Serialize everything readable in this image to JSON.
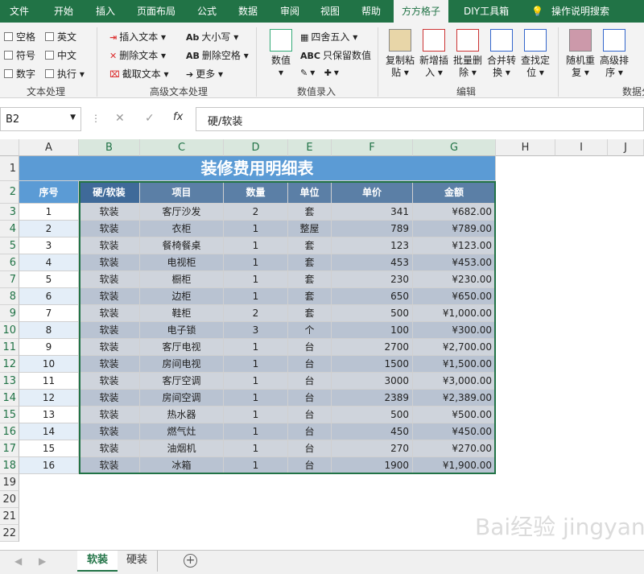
{
  "tabs": [
    "文件",
    "开始",
    "插入",
    "页面布局",
    "公式",
    "数据",
    "审阅",
    "视图",
    "帮助",
    "方方格子",
    "DIY工具箱",
    "操作说明搜索"
  ],
  "ribbon": {
    "group1": {
      "label": "文本处理",
      "items": [
        "空格",
        "英文",
        "符号",
        "中文",
        "数字",
        "执行"
      ]
    },
    "group2": {
      "label": "高级文本处理",
      "items": [
        "插入文本",
        "大小写",
        "删除文本",
        "删除空格",
        "截取文本",
        "更多"
      ]
    },
    "group3": {
      "label": "数值录入",
      "big": "数值",
      "items": [
        "四舍五入",
        "只保留数值"
      ]
    },
    "group4": {
      "label": "编辑",
      "items": [
        "复制粘贴",
        "新增插入",
        "批量删除",
        "合并转换",
        "查找定位"
      ]
    },
    "group5": {
      "label": "数据分",
      "items": [
        "随机重复",
        "高级排序"
      ]
    }
  },
  "namebox": "B2",
  "formula": "硬/软装",
  "columns": [
    "A",
    "B",
    "C",
    "D",
    "E",
    "F",
    "G",
    "H",
    "I",
    "J"
  ],
  "title": "装修费用明细表",
  "headers": [
    "序号",
    "硬/软装",
    "项目",
    "数量",
    "单位",
    "单价",
    "金额"
  ],
  "rows": [
    [
      "1",
      "软装",
      "客厅沙发",
      "2",
      "套",
      "341",
      "¥682.00"
    ],
    [
      "2",
      "软装",
      "衣柜",
      "1",
      "整屋",
      "789",
      "¥789.00"
    ],
    [
      "3",
      "软装",
      "餐椅餐桌",
      "1",
      "套",
      "123",
      "¥123.00"
    ],
    [
      "4",
      "软装",
      "电视柜",
      "1",
      "套",
      "453",
      "¥453.00"
    ],
    [
      "5",
      "软装",
      "橱柜",
      "1",
      "套",
      "230",
      "¥230.00"
    ],
    [
      "6",
      "软装",
      "边柜",
      "1",
      "套",
      "650",
      "¥650.00"
    ],
    [
      "7",
      "软装",
      "鞋柜",
      "2",
      "套",
      "500",
      "¥1,000.00"
    ],
    [
      "8",
      "软装",
      "电子锁",
      "3",
      "个",
      "100",
      "¥300.00"
    ],
    [
      "9",
      "软装",
      "客厅电视",
      "1",
      "台",
      "2700",
      "¥2,700.00"
    ],
    [
      "10",
      "软装",
      "房间电视",
      "1",
      "台",
      "1500",
      "¥1,500.00"
    ],
    [
      "11",
      "软装",
      "客厅空调",
      "1",
      "台",
      "3000",
      "¥3,000.00"
    ],
    [
      "12",
      "软装",
      "房间空调",
      "1",
      "台",
      "2389",
      "¥2,389.00"
    ],
    [
      "13",
      "软装",
      "热水器",
      "1",
      "台",
      "500",
      "¥500.00"
    ],
    [
      "14",
      "软装",
      "燃气灶",
      "1",
      "台",
      "450",
      "¥450.00"
    ],
    [
      "15",
      "软装",
      "油烟机",
      "1",
      "台",
      "270",
      "¥270.00"
    ],
    [
      "16",
      "软装",
      "冰箱",
      "1",
      "台",
      "1900",
      "¥1,900.00"
    ]
  ],
  "rowNumbers": [
    "1",
    "2",
    "3",
    "4",
    "5",
    "6",
    "7",
    "8",
    "9",
    "10",
    "11",
    "12",
    "13",
    "14",
    "15",
    "16",
    "17",
    "18",
    "19",
    "20",
    "21",
    "22"
  ],
  "sheets": [
    "软装",
    "硬装"
  ],
  "watermark": "Bai经验 jingyan.baidu.com"
}
